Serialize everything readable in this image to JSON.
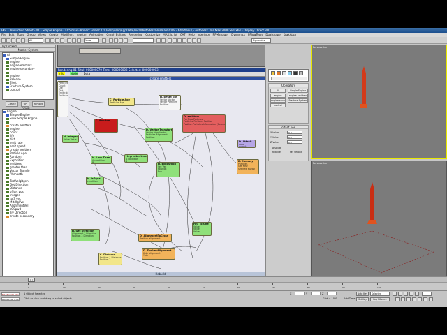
{
  "window": {
    "title": "FX4 - Production Sheet - 01 - Simple Engine - FX5.max - Project Folder: C:\\Users\\user\\AppData\\Local\\Autodesk\\3dsmax\\2009 - 64bit\\enu\\ - Autodesk 3ds Max 2009 SP1 x64 - Display: Direct 3D"
  },
  "menu": [
    "File",
    "Edit",
    "Tools",
    "Group",
    "Views",
    "Create",
    "Modifiers",
    "reactor",
    "Animation",
    "Graph Editors",
    "Rendering",
    "Customize",
    "MAXScript",
    "CAT",
    "Help",
    "Interface",
    "RPManager",
    "Dynamics",
    "PFlowTools",
    "Dualshape",
    "KrakAtoa"
  ],
  "toolbar": {
    "selection_filter": "All",
    "view_dropdown": "View",
    "named_selection": "",
    "snap_label": "Dynamics"
  },
  "tree_panel": {
    "title": "TopDocked",
    "depot_title": "Master System",
    "top_items": [
      {
        "label": "All",
        "icon": "blue"
      },
      {
        "label": "Simple Engine",
        "icon": "blue"
      },
      {
        "label": "engine",
        "icon": "green"
      },
      {
        "label": "engine emitters",
        "icon": "green"
      },
      {
        "label": "engine secondary",
        "icon": "green"
      },
      {
        "label": "",
        "icon": "green"
      },
      {
        "label": "engine",
        "icon": "green"
      },
      {
        "label": "Release",
        "icon": "green"
      },
      {
        "label": "Eject",
        "icon": "green"
      },
      {
        "label": "Fracture System",
        "icon": "blue"
      },
      {
        "label": "control",
        "icon": "green"
      }
    ],
    "buttons_top": [
      "Create",
      "UP DOWN",
      "Remove"
    ],
    "bottom_items": [
      {
        "label": "Engine",
        "icon": "blue"
      },
      {
        "label": "Simple Engine",
        "icon": "blue"
      },
      {
        "label": "Slow Simple Engine",
        "icon": "green"
      },
      {
        "label": "",
        "icon": "green"
      },
      {
        "label": "create emitters",
        "icon": "orange"
      },
      {
        "label": "engine",
        "icon": "green"
      },
      {
        "label": "count",
        "icon": "green"
      },
      {
        "label": "life",
        "icon": "green"
      },
      {
        "label": "dist",
        "icon": "green"
      },
      {
        "label": "emit rate",
        "icon": "green"
      },
      {
        "label": "emit speed",
        "icon": "green"
      },
      {
        "label": "create emitters",
        "icon": "orange"
      },
      {
        "label": "Particle Age",
        "icon": "green"
      },
      {
        "label": "Random",
        "icon": "green"
      },
      {
        "label": "Exposition",
        "icon": "green"
      },
      {
        "label": "emitters",
        "icon": "green"
      },
      {
        "label": "greater than",
        "icon": "green"
      },
      {
        "label": "Vector Transfo",
        "icon": "green"
      },
      {
        "label": "Pitchpath",
        "icon": "green"
      },
      {
        "label": "",
        "icon": "green"
      },
      {
        "label": "TestVelgltgen",
        "icon": "green"
      },
      {
        "label": "Get Direction",
        "icon": "green"
      },
      {
        "label": "Distance",
        "icon": "green"
      },
      {
        "label": "offset pos",
        "icon": "green"
      },
      {
        "label": "integer",
        "icon": "green"
      },
      {
        "label": "to 3 vec",
        "icon": "green"
      },
      {
        "label": "M.t.Xgl.Vel",
        "icon": "green"
      },
      {
        "label": "AlignmentVel",
        "icon": "green"
      },
      {
        "label": "sOSpwd",
        "icon": "green"
      },
      {
        "label": "Tiv Direction",
        "icon": "green"
      },
      {
        "label": "create secondary",
        "icon": "orange"
      }
    ],
    "buttons_bottom": [
      "Create",
      "UP DOWN",
      "Remove"
    ]
  },
  "node_editor": {
    "title": "create emitters",
    "toolbar_label": "Rendering 01   Total: 000000070   Time: 000000003   Selected: 000000003",
    "tabs": [
      "Info",
      "Node",
      "Data"
    ],
    "status": "Rebuild",
    "nodes": [
      {
        "id": "particle-loop",
        "title": "",
        "ports": [
          "Particles",
          "Count",
          "Life",
          "Dist",
          "Emit rate",
          "Emit speed"
        ],
        "color": "white"
      },
      {
        "id": "particle-age",
        "title": "C. Particle Age",
        "ports": [
          "Particles   Age"
        ],
        "color": "yellow"
      },
      {
        "id": "offset-pos",
        "title": "H. offset pos",
        "ports": [
          "Vector   Vector",
          "Vector   Particles",
          "Position"
        ],
        "color": "white"
      },
      {
        "id": "integer",
        "title": "H. Integer",
        "ports": [
          "Value   Value"
        ],
        "color": "green"
      },
      {
        "id": "random",
        "title": "C. Random",
        "ports": [
          "",
          ""
        ],
        "color": "dkred"
      },
      {
        "id": "vector-transform",
        "title": "D. Vector Transform",
        "ports": [
          "Vector   New Vector",
          "Particles   Alignment",
          "Position"
        ],
        "color": "green"
      },
      {
        "id": "emitters",
        "title": "D. emitters",
        "ports": [
          "Par   New Particles",
          "Particles   Particles Position",
          "Position   Particles Information (Geometry)"
        ],
        "color": "red"
      },
      {
        "id": "attach",
        "title": "D. Attach",
        "ports": [
          "data",
          "output"
        ],
        "color": "purple"
      },
      {
        "id": "memory",
        "title": "D. Memory",
        "ports": [
          "Particles",
          "Get New",
          "Set new spawn"
        ],
        "color": "orange"
      },
      {
        "id": "less-than",
        "title": "H. Less Than",
        "ports": [
          "A   condition",
          "B"
        ],
        "color": "green"
      },
      {
        "id": "greater-than",
        "title": "H. greater than",
        "ports": [
          "A   condition",
          "B"
        ],
        "color": "green"
      },
      {
        "id": "exposition",
        "title": "H. Exposition",
        "ports": [
          "Vec   Vec",
          "Position",
          "Exp"
        ],
        "color": "green"
      },
      {
        "id": "is-equal",
        "title": "H. IsEqual",
        "ports": [
          "condition"
        ],
        "color": "green"
      },
      {
        "id": "get-direction",
        "title": "H. Get Direction",
        "ports": [
          "Alignment   3 Direction",
          "Position   3 Direction"
        ],
        "color": "green"
      },
      {
        "id": "alignment-to-cross",
        "title": "D. AlignmentToCross",
        "ports": [
          "Position   alignment"
        ],
        "color": "orange"
      },
      {
        "id": "distance",
        "title": "C. Distance",
        "ports": [
          "Position 1   Distance",
          "Position 2"
        ],
        "color": "yellow"
      },
      {
        "id": "two-vec-alignment",
        "title": "D. TwoVecAlignment",
        "ports": [
          "X dir   alignment",
          "Y dir"
        ],
        "color": "orange"
      },
      {
        "id": "h-to-one",
        "title": "H.G To One",
        "ports": [
          "Value",
          "Value",
          "Value"
        ],
        "color": "green"
      }
    ]
  },
  "command_panel": {
    "title": "Operators",
    "buttons": [
      "All",
      "Simple Engine",
      "engine",
      "engine emitters",
      "engine secondary",
      "Fracture System",
      "control"
    ],
    "offset_title": "offset pos",
    "axes": [
      {
        "label": "X Value",
        "value": "0.0"
      },
      {
        "label": "Y Value",
        "value": "0.0"
      },
      {
        "label": "Z Value",
        "value": "0.0"
      }
    ],
    "options": [
      "Absolute",
      "Relative",
      "Per Second"
    ]
  },
  "viewports": {
    "top_label": "Perspective",
    "bottom_label": "Perspective"
  },
  "timeline": {
    "frame": "0 / 100",
    "ticks": [
      "0",
      "10",
      "20",
      "30",
      "40",
      "50",
      "60",
      "70",
      "80",
      "90",
      "100"
    ]
  },
  "status": {
    "selection": "1 Object Selected",
    "prompt": "Click or click-and-drag to select objects",
    "left_box_1": "MAXScript Listener",
    "left_box_2": "Rendering: 0.0s",
    "x_label": "X",
    "y_label": "Y",
    "z_label": "Z",
    "grid": "Grid = 10.0",
    "auto_key": "Auto Key",
    "selected": "Selected",
    "set_key": "Set Key",
    "key_filters": "Key Filters...",
    "add_time_tag": "Add Time Tag"
  }
}
